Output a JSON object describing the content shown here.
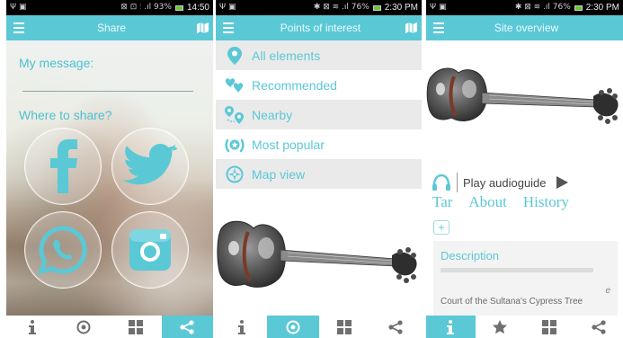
{
  "screens": [
    {
      "status": {
        "left_glyphs": "Ψ ▣",
        "right_glyphs": "⊠ ⊡ ⫶ .ıl 93%",
        "time": "14:50"
      },
      "title": "Share",
      "message_label": "My message:",
      "share_label": "Where to share?",
      "share_targets": [
        "facebook",
        "twitter",
        "whatsapp",
        "instagram"
      ],
      "tabs": [
        "info-icon",
        "target-icon",
        "grid-icon",
        "share-icon"
      ],
      "active_tab": 3
    },
    {
      "status": {
        "left_glyphs": "Ψ ▣",
        "right_glyphs": "✱ ⊠ ≋ .ıl 76%",
        "time": "2:30 PM"
      },
      "title": "Points of interest",
      "items": [
        {
          "label": "All elements",
          "icon": "map-pin-icon"
        },
        {
          "label": "Recommended",
          "icon": "hearts-icon"
        },
        {
          "label": "Nearby",
          "icon": "nearby-pins-icon"
        },
        {
          "label": "Most popular",
          "icon": "popular-icon"
        },
        {
          "label": "Map view",
          "icon": "compass-icon"
        }
      ],
      "tabs": [
        "info-icon",
        "target-icon",
        "grid-icon",
        "share-icon"
      ],
      "active_tab": 1
    },
    {
      "status": {
        "left_glyphs": "Ψ ▣",
        "right_glyphs": "✱ ⊠ ≋ .ıl 76%",
        "time": "2:30 PM"
      },
      "title": "Site overview",
      "audio_label": "Play audioguide",
      "content_tabs": [
        "Tar",
        "About",
        "History"
      ],
      "plus": "+",
      "description_title": "Description",
      "description_text": "Court of the Sultana's Cypress Tree",
      "description_mark": "e",
      "tabs": [
        "info-icon",
        "star-icon",
        "grid-icon",
        "share-icon"
      ],
      "active_tab": 0
    }
  ],
  "colors": {
    "accent": "#5bc8d6",
    "status_bar": "#000000",
    "tab_inactive": "#6f6f6f"
  }
}
